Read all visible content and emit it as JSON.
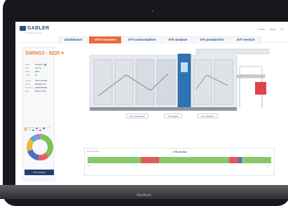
{
  "device": {
    "brand_label": "MacBook"
  },
  "header": {
    "logo_text": "GABLER",
    "logo_sub": "Technology you trust",
    "tools": [
      "Gabler",
      "Dieter",
      "DE"
    ]
  },
  "tabs": [
    {
      "label": "Dashboard",
      "active": false
    },
    {
      "label": "GTI overview",
      "active": true
    },
    {
      "label": "GTI consumption",
      "active": false
    },
    {
      "label": "GTI analyse",
      "active": false
    },
    {
      "label": "GTI production",
      "active": false
    },
    {
      "label": "GTI service",
      "active": false
    }
  ],
  "sidebar": {
    "machine_name": "SWING3 - 6235 ▾",
    "properties": [
      {
        "label": "Status",
        "value": "Production",
        "status_dot": true
      },
      {
        "label": "Type",
        "value": "GD 1.64",
        "status_dot": false
      },
      {
        "label": "Serial",
        "value": "298 H",
        "status_dot": false
      },
      {
        "label": "Count",
        "value": "24",
        "status_dot": false
      },
      {
        "label": "Tooling",
        "value": "GHS 1.64.05.88",
        "status_dot": false
      },
      {
        "label": "Article",
        "value": "WZ2356 / 2.14",
        "status_dot": false
      },
      {
        "label": "Personnel",
        "value": "1150/2019/6923",
        "status_dot": false
      },
      {
        "label": "Date",
        "value": "08.05.2 10 min",
        "status_dot": false
      }
    ],
    "legend": [
      {
        "name": "Production",
        "color": "#7ec05a"
      },
      {
        "name": "Stop",
        "color": "#e85e5e"
      },
      {
        "name": "Service",
        "color": "#4c6fc2"
      },
      {
        "name": "Setup",
        "color": "#f0b73a"
      },
      {
        "name": "Idle",
        "color": "#46b6d8"
      },
      {
        "name": "Other",
        "color": "#b27ad8"
      }
    ],
    "donut_segments": [
      {
        "name": "Production",
        "value": 38,
        "color": "#7ec05a"
      },
      {
        "name": "Stop",
        "value": 14,
        "color": "#e85e5e"
      },
      {
        "name": "Service",
        "value": 18,
        "color": "#4c6fc2"
      },
      {
        "name": "Setup",
        "value": 16,
        "color": "#f0b73a"
      },
      {
        "name": "Idle",
        "value": 8,
        "color": "#46b6d8"
      },
      {
        "name": "Other",
        "value": 6,
        "color": "#b27ad8"
      }
    ],
    "button_label": "GTI Overview"
  },
  "machine_buttons": [
    "GTI consumption",
    "GTI analyse",
    "GTI production"
  ],
  "status_panel": {
    "title": "GTI service",
    "subtitle": "Machine status",
    "from_label": "8:00",
    "to_label": "16:00",
    "segments": [
      {
        "state": "Production",
        "fraction": 0.29,
        "color": "#86c96a"
      },
      {
        "state": "Stop",
        "fraction": 0.1,
        "color": "#e25b5b"
      },
      {
        "state": "Production",
        "fraction": 0.38,
        "color": "#86c96a"
      },
      {
        "state": "Stop",
        "fraction": 0.05,
        "color": "#e25b5b"
      },
      {
        "state": "Service",
        "fraction": 0.02,
        "color": "#4c6fc2"
      },
      {
        "state": "Production",
        "fraction": 0.16,
        "color": "#86c96a"
      }
    ]
  },
  "colors": {
    "accent": "#e86a3d",
    "brand": "#2b4e7e",
    "dark_band": "#1f3d66"
  }
}
